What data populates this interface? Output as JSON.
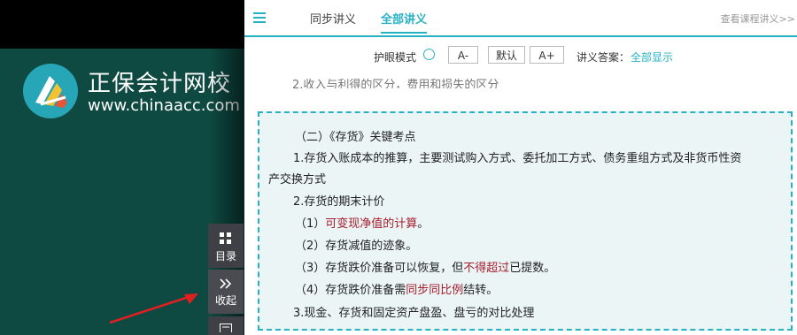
{
  "brand": {
    "name_cn": "正保会计网校",
    "url": "www.chinaacc.com"
  },
  "sidebar_buttons": {
    "toc": "目录",
    "collapse": "收起"
  },
  "header": {
    "tabs": [
      {
        "label": "同步讲义",
        "active": false
      },
      {
        "label": "全部讲义",
        "active": true
      }
    ],
    "view_course": "查看课程讲义>>"
  },
  "toolbar": {
    "eye_mode": "护眼模式",
    "font_smaller": "A-",
    "font_default": "默认",
    "font_larger": "A+",
    "answer_label": "讲义答案：",
    "answer_value": "全部显示"
  },
  "partial_line": "2.收入与利得的区分，费用和损失的区分",
  "notes": {
    "heading": "（二）《存货》关键考点",
    "item1_line1": "1.存货入账成本的推算，主要测试购入方式、委托加工方式、债务重组方式及非货币性资",
    "item1_line2": "产交换方式",
    "item2": "2.存货的期末计价",
    "sub1_prefix": "（1）",
    "sub1_red": "可变现净值的计算",
    "sub1_suffix": "。",
    "sub2": "（2）存货减值的迹象。",
    "sub3_prefix": "（3）存货跌价准备可以恢复，但",
    "sub3_red": "不得超过",
    "sub3_suffix": "已提数。",
    "sub4_prefix": "（4）存货跌价准备需",
    "sub4_red": "同步同比例",
    "sub4_suffix": "结转。",
    "item3": "3.现金、存货和固定资产盘盈、盘亏的对比处理"
  },
  "colors": {
    "accent": "#27b2c4",
    "emphasis": "#a51d2d",
    "left_bg": "#0e4a41",
    "notes_bg": "#ebf5f6"
  }
}
